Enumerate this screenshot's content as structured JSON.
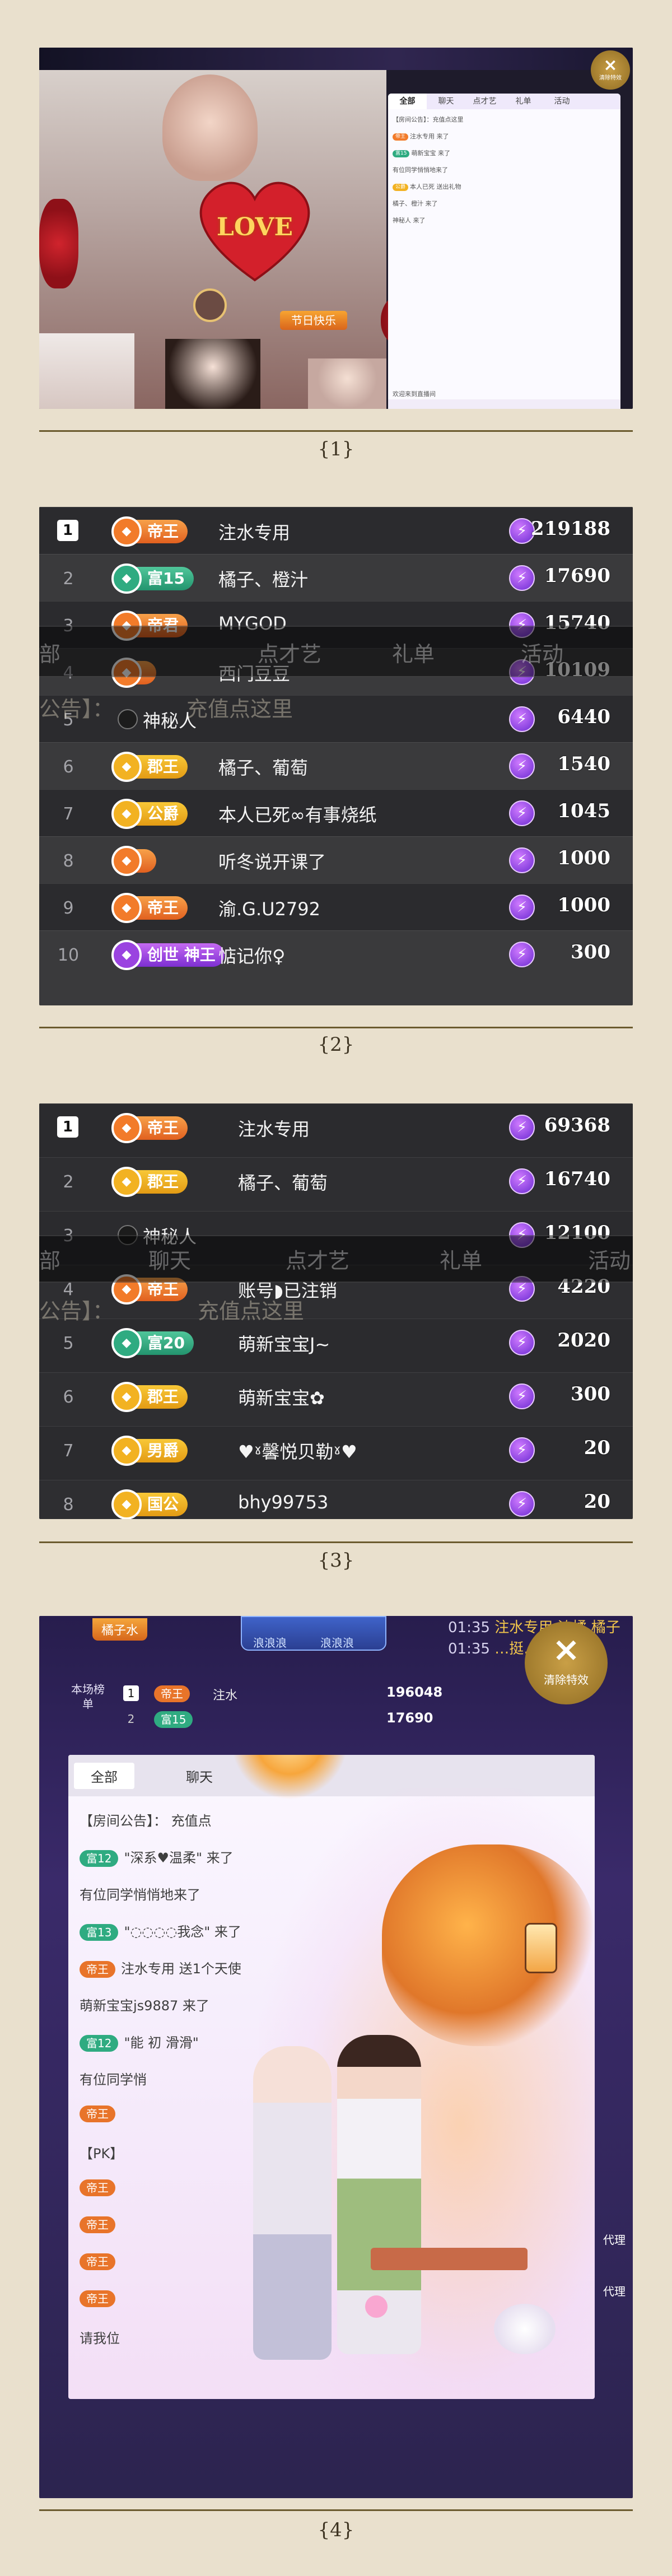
{
  "captions": [
    "{1}",
    "{2}",
    "{3}",
    "{4}"
  ],
  "panel1": {
    "overlay_title": "LOVE",
    "overlay_banner": "节日快乐",
    "chat_tabs": [
      "全部",
      "聊天",
      "点才艺",
      "礼单",
      "活动"
    ],
    "chat_lines": [
      "【房间公告】：充值点这里",
      "注水专用 来了",
      "萌新宝宝 来了",
      "有位同学悄悄地来了",
      "本人已死 送出礼物",
      "橘子、橙汁 来了",
      "神秘人 来了",
      "欢迎来到直播间"
    ],
    "close_label": "清除特效"
  },
  "panel2": {
    "rows": [
      {
        "rank": "1",
        "badge": "帝王",
        "badge_style": "orange",
        "name": "注水专用",
        "amount": "219188"
      },
      {
        "rank": "2",
        "badge": "富15",
        "badge_style": "green",
        "name": "橘子、橙汁",
        "amount": "17690"
      },
      {
        "rank": "3",
        "badge": "帝君",
        "badge_style": "orange",
        "name": "MYGOD",
        "amount": "15740"
      },
      {
        "rank": "4",
        "badge": "",
        "badge_style": "orange",
        "name": "西门豆豆",
        "amount": "10109"
      },
      {
        "rank": "5",
        "badge": "",
        "badge_style": "none",
        "name": "神秘人",
        "amount": "6440"
      },
      {
        "rank": "6",
        "badge": "郡王",
        "badge_style": "gold",
        "name": "橘子、葡萄",
        "amount": "1540"
      },
      {
        "rank": "7",
        "badge": "公爵",
        "badge_style": "gold",
        "name": "本人已死∞有事烧纸",
        "amount": "1045"
      },
      {
        "rank": "8",
        "badge": "",
        "badge_style": "orange",
        "name": "听冬说开课了",
        "amount": "1000"
      },
      {
        "rank": "9",
        "badge": "帝王",
        "badge_style": "orange",
        "name": "渝.G.U2792",
        "amount": "1000"
      },
      {
        "rank": "10",
        "badge": "创世 神王",
        "badge_style": "purple",
        "name": "惦记你♀",
        "amount": "300"
      }
    ],
    "ghost_tabs": [
      "部",
      "点才艺",
      "礼单",
      "活动"
    ],
    "ghost_notice": "公告】：",
    "ghost_notice_link": "充值点这里"
  },
  "panel3": {
    "rows": [
      {
        "rank": "1",
        "badge": "帝王",
        "badge_style": "orange",
        "name": "注水专用",
        "amount": "69368"
      },
      {
        "rank": "2",
        "badge": "郡王",
        "badge_style": "gold",
        "name": "橘子、葡萄",
        "amount": "16740"
      },
      {
        "rank": "3",
        "badge": "",
        "badge_style": "none",
        "name": "神秘人",
        "amount": "12100"
      },
      {
        "rank": "4",
        "badge": "帝王",
        "badge_style": "orange",
        "name": "账号◗已注销",
        "amount": "4220"
      },
      {
        "rank": "5",
        "badge": "富20",
        "badge_style": "green",
        "name": "萌新宝宝J~",
        "amount": "2020"
      },
      {
        "rank": "6",
        "badge": "郡王",
        "badge_style": "gold",
        "name": "萌新宝宝✿",
        "amount": "300"
      },
      {
        "rank": "7",
        "badge": "男爵",
        "badge_style": "gold",
        "name": "♥ˠ馨悦贝勒ˠ♥",
        "amount": "20"
      },
      {
        "rank": "8",
        "badge": "国公",
        "badge_style": "gold",
        "name": "bhy99753",
        "amount": "20"
      }
    ],
    "ghost_tabs": [
      "部",
      "聊天",
      "点才艺",
      "礼单",
      "活动"
    ],
    "ghost_notice": "公告】：",
    "ghost_notice_link": "充值点这里"
  },
  "panel4": {
    "top_names": [
      "浪浪浪",
      "浪浪浪"
    ],
    "top_left_label": "橘子水",
    "time1": "01:35",
    "time1_text": "注水专用 浓橘 橘子",
    "time2": "01:35",
    "time2_text": "…挺…",
    "rank_box_label": "本场榜单",
    "mini_rows": [
      {
        "rank": "1",
        "badge": "帝王",
        "badge_style": "orange",
        "name": "注水",
        "amount": "196048"
      },
      {
        "rank": "2",
        "badge": "富15",
        "badge_style": "green",
        "name": "",
        "amount": "17690"
      }
    ],
    "close_label": "清除特效",
    "tabs": [
      "全部",
      "聊天"
    ],
    "lines": [
      {
        "badge": "",
        "badge_style": "none",
        "text": "【房间公告】：       充值点"
      },
      {
        "badge": "富12",
        "badge_style": "green",
        "text": "\"深系♥温柔\" 来了"
      },
      {
        "badge": "",
        "badge_style": "none",
        "text": "有位同学悄悄地来了"
      },
      {
        "badge": "富13",
        "badge_style": "green",
        "text": "\"◌◌◌◌我念\" 来了"
      },
      {
        "badge": "帝王",
        "badge_style": "orange",
        "text": "注水专用 送1个天使"
      },
      {
        "badge": "",
        "badge_style": "none",
        "text": "萌新宝宝js9887 来了"
      },
      {
        "badge": "富12",
        "badge_style": "green",
        "text": "\"能 初       滑滑\""
      },
      {
        "badge": "",
        "badge_style": "none",
        "text": "有位同学悄"
      },
      {
        "badge": "帝王",
        "badge_style": "orange",
        "text": ""
      },
      {
        "badge": "",
        "badge_style": "none",
        "text": "【PK】"
      },
      {
        "badge": "帝王",
        "badge_style": "orange",
        "text": ""
      },
      {
        "badge": "帝王",
        "badge_style": "orange",
        "text": ""
      },
      {
        "badge": "帝王",
        "badge_style": "orange",
        "text": ""
      },
      {
        "badge": "帝王",
        "badge_style": "orange",
        "text": ""
      },
      {
        "badge": "",
        "badge_style": "none",
        "text": "请我位"
      }
    ],
    "side_labels": [
      "代理",
      "代理"
    ]
  }
}
